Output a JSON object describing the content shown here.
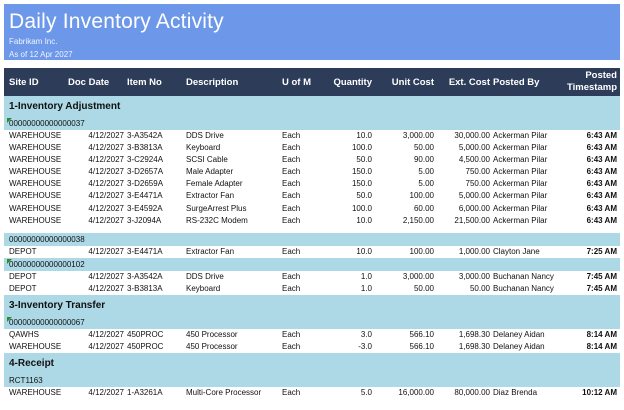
{
  "report": {
    "title": "Daily Inventory Activity",
    "company": "Fabrikam Inc.",
    "as_of": "As of 12 Apr 2027"
  },
  "columns": {
    "site_id": "Site ID",
    "doc_date": "Doc Date",
    "item_no": "Item No",
    "description": "Description",
    "uom": "U of M",
    "quantity": "Quantity",
    "unit_cost": "Unit Cost",
    "ext_cost": "Ext. Cost",
    "posted_by": "Posted By",
    "posted_ts_line1": "Posted",
    "posted_ts_line2": "Timestamp"
  },
  "groups": [
    {
      "label": "1-Inventory Adjustment",
      "docs": [
        {
          "doc_no": "00000000000000037",
          "marker": true,
          "rows": [
            {
              "site": "WAREHOUSE",
              "date": "4/12/2027",
              "item": "3-A3542A",
              "desc": "DDS Drive",
              "uom": "Each",
              "qty": "10.0",
              "unit": "3,000.00",
              "ext": "30,000.00",
              "by": "Ackerman Pilar",
              "ts": "6:43 AM"
            },
            {
              "site": "WAREHOUSE",
              "date": "4/12/2027",
              "item": "3-B3813A",
              "desc": "Keyboard",
              "uom": "Each",
              "qty": "100.0",
              "unit": "50.00",
              "ext": "5,000.00",
              "by": "Ackerman Pilar",
              "ts": "6:43 AM"
            },
            {
              "site": "WAREHOUSE",
              "date": "4/12/2027",
              "item": "3-C2924A",
              "desc": "SCSI Cable",
              "uom": "Each",
              "qty": "50.0",
              "unit": "90.00",
              "ext": "4,500.00",
              "by": "Ackerman Pilar",
              "ts": "6:43 AM"
            },
            {
              "site": "WAREHOUSE",
              "date": "4/12/2027",
              "item": "3-D2657A",
              "desc": "Male Adapter",
              "uom": "Each",
              "qty": "150.0",
              "unit": "5.00",
              "ext": "750.00",
              "by": "Ackerman Pilar",
              "ts": "6:43 AM"
            },
            {
              "site": "WAREHOUSE",
              "date": "4/12/2027",
              "item": "3-D2659A",
              "desc": "Female Adapter",
              "uom": "Each",
              "qty": "150.0",
              "unit": "5.00",
              "ext": "750.00",
              "by": "Ackerman Pilar",
              "ts": "6:43 AM"
            },
            {
              "site": "WAREHOUSE",
              "date": "4/12/2027",
              "item": "3-E4471A",
              "desc": "Extractor Fan",
              "uom": "Each",
              "qty": "50.0",
              "unit": "100.00",
              "ext": "5,000.00",
              "by": "Ackerman Pilar",
              "ts": "6:43 AM"
            },
            {
              "site": "WAREHOUSE",
              "date": "4/12/2027",
              "item": "3-E4592A",
              "desc": "SurgeArrest Plus",
              "uom": "Each",
              "qty": "100.0",
              "unit": "60.00",
              "ext": "6,000.00",
              "by": "Ackerman Pilar",
              "ts": "6:43 AM"
            },
            {
              "site": "WAREHOUSE",
              "date": "4/12/2027",
              "item": "3-J2094A",
              "desc": "RS-232C Modem",
              "uom": "Each",
              "qty": "10.0",
              "unit": "2,150.00",
              "ext": "21,500.00",
              "by": "Ackerman Pilar",
              "ts": "6:43 AM"
            }
          ]
        },
        {
          "doc_no": "00000000000000038",
          "marker": false,
          "rows": [
            {
              "site": "DEPOT",
              "date": "4/12/2027",
              "item": "3-E4471A",
              "desc": "Extractor Fan",
              "uom": "Each",
              "qty": "10.0",
              "unit": "100.00",
              "ext": "1,000.00",
              "by": "Clayton Jane",
              "ts": "7:25 AM"
            }
          ]
        },
        {
          "doc_no": "00000000000000102",
          "marker": true,
          "rows": [
            {
              "site": "DEPOT",
              "date": "4/12/2027",
              "item": "3-A3542A",
              "desc": "DDS Drive",
              "uom": "Each",
              "qty": "1.0",
              "unit": "3,000.00",
              "ext": "3,000.00",
              "by": "Buchanan Nancy",
              "ts": "7:45 AM"
            },
            {
              "site": "DEPOT",
              "date": "4/12/2027",
              "item": "3-B3813A",
              "desc": "Keyboard",
              "uom": "Each",
              "qty": "1.0",
              "unit": "50.00",
              "ext": "50.00",
              "by": "Buchanan Nancy",
              "ts": "7:45 AM"
            }
          ]
        }
      ]
    },
    {
      "label": "3-Inventory Transfer",
      "docs": [
        {
          "doc_no": "00000000000000067",
          "marker": true,
          "rows": [
            {
              "site": "QAWHS",
              "date": "4/12/2027",
              "item": "450PROC",
              "desc": "450 Processor",
              "uom": "Each",
              "qty": "3.0",
              "unit": "566.10",
              "ext": "1,698.30",
              "by": "Delaney Aidan",
              "ts": "8:14 AM"
            },
            {
              "site": "WAREHOUSE",
              "date": "4/12/2027",
              "item": "450PROC",
              "desc": "450 Processor",
              "uom": "Each",
              "qty": "-3.0",
              "unit": "566.10",
              "ext": "1,698.30",
              "by": "Delaney Aidan",
              "ts": "8:14 AM"
            }
          ]
        }
      ]
    },
    {
      "label": "4-Receipt",
      "docs": [
        {
          "doc_no": "RCT1163",
          "marker": false,
          "rows": [
            {
              "site": "WAREHOUSE",
              "date": "4/12/2027",
              "item": "1-A3261A",
              "desc": "Multi-Core Processor",
              "uom": "Each",
              "qty": "5.0",
              "unit": "16,000.00",
              "ext": "80,000.00",
              "by": "Diaz Brenda",
              "ts": "10:12 AM",
              "ts_bold": true
            }
          ]
        }
      ]
    }
  ],
  "colors": {
    "banner": "#6d97e8",
    "header": "#2d3d59",
    "group_band": "#add8e6",
    "marker": "#2e8b2e"
  }
}
